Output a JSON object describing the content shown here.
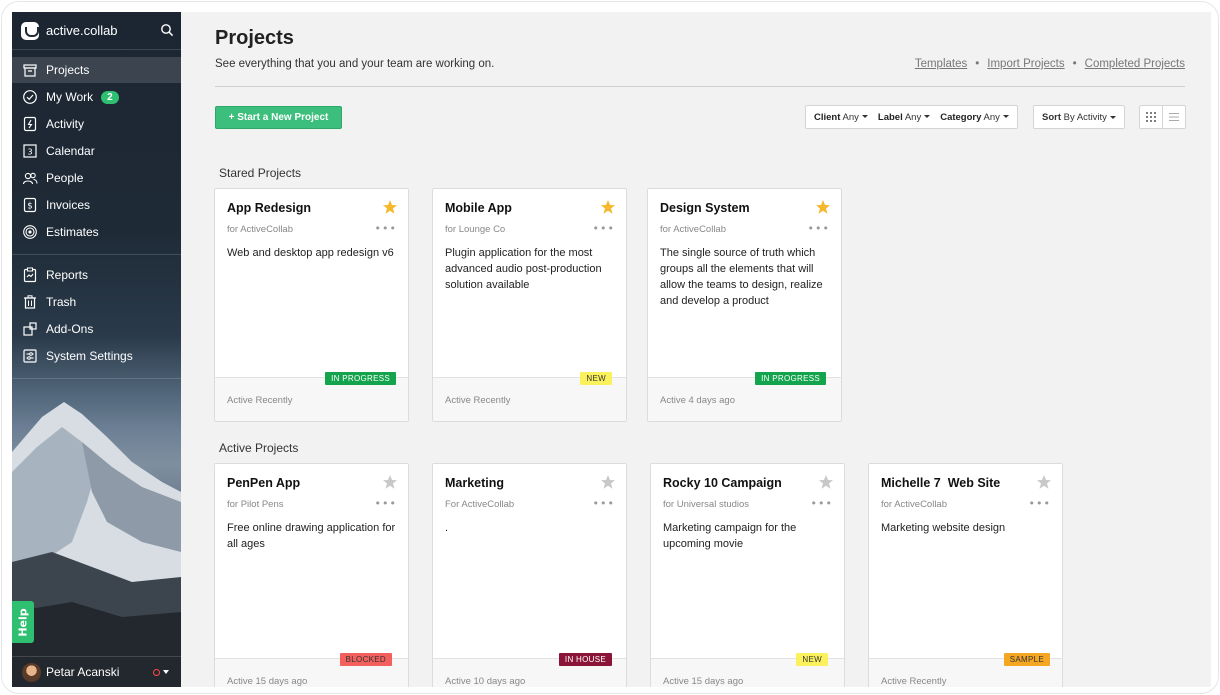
{
  "app": {
    "logo_text": "active.collab",
    "help_label": "Help",
    "user_name": "Petar Acanski"
  },
  "sidebar": {
    "items": [
      {
        "label": "Projects",
        "icon": "projects-icon"
      },
      {
        "label": "My Work",
        "icon": "check-circle-icon",
        "badge": "2"
      },
      {
        "label": "Activity",
        "icon": "activity-icon"
      },
      {
        "label": "Calendar",
        "icon": "calendar-icon",
        "icon_text": "3"
      },
      {
        "label": "People",
        "icon": "people-icon"
      },
      {
        "label": "Invoices",
        "icon": "invoice-icon"
      },
      {
        "label": "Estimates",
        "icon": "estimates-icon"
      },
      {
        "label": "Reports",
        "icon": "reports-icon"
      },
      {
        "label": "Trash",
        "icon": "trash-icon"
      },
      {
        "label": "Add-Ons",
        "icon": "addons-icon"
      },
      {
        "label": "System Settings",
        "icon": "settings-icon"
      }
    ]
  },
  "header": {
    "title": "Projects",
    "subtitle": "See everything that you and your team are working on.",
    "links": [
      "Templates",
      "Import Projects",
      "Completed Projects"
    ],
    "link_sep": "•"
  },
  "toolbar": {
    "new_project_label": "+ Start a New Project",
    "filters": [
      {
        "name": "Client",
        "value": "Any"
      },
      {
        "name": "Label",
        "value": "Any"
      },
      {
        "name": "Category",
        "value": "Any"
      }
    ],
    "sort": {
      "name": "Sort",
      "value": "By Activity"
    }
  },
  "sections": {
    "starred_title": "Stared Projects",
    "active_title": "Active Projects"
  },
  "starred_projects": [
    {
      "name": "App Redesign",
      "client": "for ActiveCollab",
      "description": "Web and desktop app redesign v6",
      "status": "IN PROGRESS",
      "status_bg": "#14a44d",
      "status_fg": "#ffffff",
      "activity": "Active Recently",
      "starred": true
    },
    {
      "name": "Mobile App",
      "client": "for Lounge Co",
      "description": "Plugin application for the most advanced audio post-production solution available",
      "status": "NEW",
      "status_bg": "#fbf15c",
      "status_fg": "#333333",
      "activity": "Active Recently",
      "starred": true
    },
    {
      "name": "Design System",
      "client": "for ActiveCollab",
      "description": "The single source of truth which groups all the elements that will allow the teams to design, realize and develop a product",
      "status": "IN PROGRESS",
      "status_bg": "#14a44d",
      "status_fg": "#ffffff",
      "activity": "Active 4 days ago",
      "starred": true
    }
  ],
  "active_projects": [
    {
      "name": "PenPen App",
      "client": "for Pilot Pens",
      "description": "Free online drawing application for all ages",
      "status": "BLOCKED",
      "status_bg": "#f25f5c",
      "status_fg": "#333333",
      "activity": "Active 15 days ago",
      "starred": false
    },
    {
      "name": "Marketing",
      "client": "For ActiveCollab",
      "description": ".",
      "status": "IN HOUSE",
      "status_bg": "#8b1538",
      "status_fg": "#ffffff",
      "activity": "Active 10 days ago",
      "starred": false
    },
    {
      "name": "Rocky 10 Campaign",
      "client": "for Universal studios",
      "description": "Marketing campaign for the upcoming movie",
      "status": "NEW",
      "status_bg": "#fbf15c",
      "status_fg": "#333333",
      "activity": "Active 15 days ago",
      "starred": false
    },
    {
      "name": "Michelle 7  Web Site",
      "client": "for ActiveCollab",
      "description": "Marketing website design",
      "status": "SAMPLE",
      "status_bg": "#f5a623",
      "status_fg": "#333333",
      "activity": "Active Recently",
      "starred": false
    }
  ],
  "colors": {
    "accent": "#3cbf7c",
    "star_on": "#f5b82e",
    "star_off": "#c8c8c8"
  }
}
